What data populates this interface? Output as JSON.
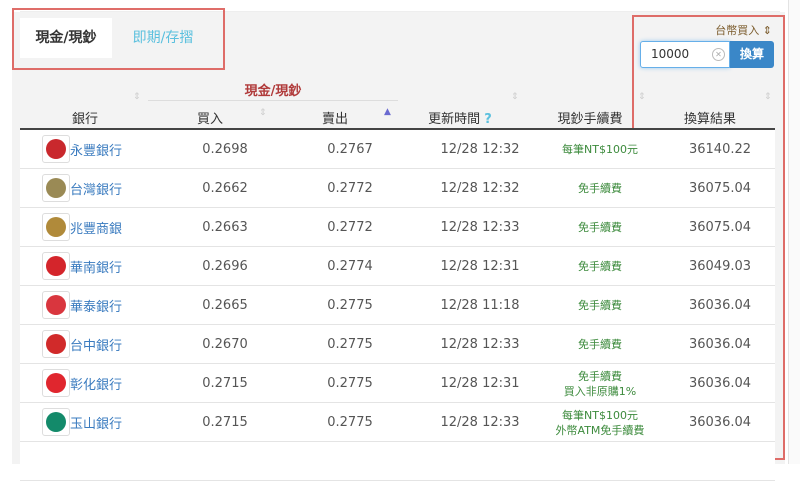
{
  "tabs": [
    {
      "label": "現金/現鈔",
      "active": true
    },
    {
      "label": "即期/存摺",
      "active": false
    }
  ],
  "converter": {
    "currency_select": "台幣買入",
    "amount": "10000",
    "submit_label": "換算"
  },
  "table": {
    "group_header": "現金/現鈔",
    "columns": [
      "銀行",
      "買入",
      "賣出",
      "更新時間",
      "現鈔手續費",
      "換算結果"
    ],
    "time_help": "?",
    "rows": [
      {
        "bank": "永豐銀行",
        "buy": "0.2698",
        "sell": "0.2767",
        "time": "12/28 12:32",
        "fee": [
          "每筆NT$100元"
        ],
        "result": "36140.22",
        "color": "#c9282d"
      },
      {
        "bank": "台灣銀行",
        "buy": "0.2662",
        "sell": "0.2772",
        "time": "12/28 12:32",
        "fee": [
          "免手續費"
        ],
        "result": "36075.04",
        "color": "#9a8a55"
      },
      {
        "bank": "兆豐商銀",
        "buy": "0.2663",
        "sell": "0.2772",
        "time": "12/28 12:33",
        "fee": [
          "免手續費"
        ],
        "result": "36075.04",
        "color": "#b08a3a"
      },
      {
        "bank": "華南銀行",
        "buy": "0.2696",
        "sell": "0.2774",
        "time": "12/28 12:31",
        "fee": [
          "免手續費"
        ],
        "result": "36049.03",
        "color": "#d4252b"
      },
      {
        "bank": "華泰銀行",
        "buy": "0.2665",
        "sell": "0.2775",
        "time": "12/28 11:18",
        "fee": [
          "免手續費"
        ],
        "result": "36036.04",
        "color": "#d9363e"
      },
      {
        "bank": "台中銀行",
        "buy": "0.2670",
        "sell": "0.2775",
        "time": "12/28 12:33",
        "fee": [
          "免手續費"
        ],
        "result": "36036.04",
        "color": "#d12a2a"
      },
      {
        "bank": "彰化銀行",
        "buy": "0.2715",
        "sell": "0.2775",
        "time": "12/28 12:31",
        "fee": [
          "免手續費",
          "買入非原購1%"
        ],
        "result": "36036.04",
        "color": "#e0262e"
      },
      {
        "bank": "玉山銀行",
        "buy": "0.2715",
        "sell": "0.2775",
        "time": "12/28 12:33",
        "fee": [
          "每筆NT$100元",
          "外幣ATM免手續費"
        ],
        "result": "36036.04",
        "color": "#138a6a"
      }
    ]
  }
}
